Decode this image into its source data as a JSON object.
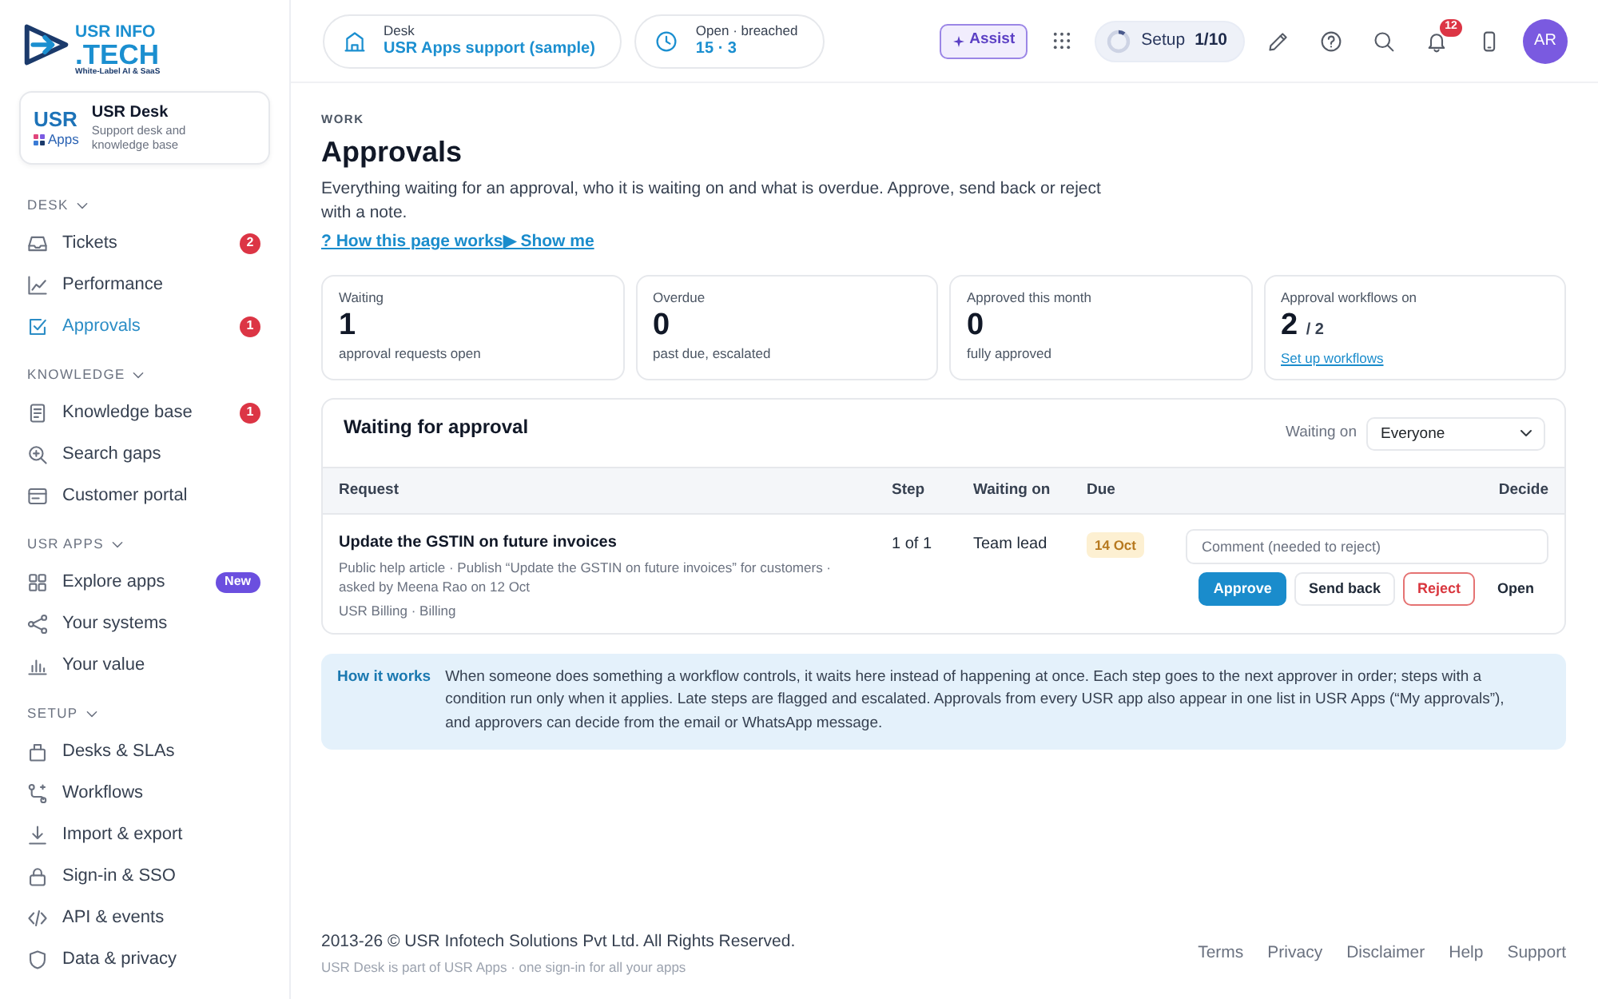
{
  "logo": {
    "title": "USR INFO",
    "subtitle": ".TECH",
    "tagline": "White-Label AI & SaaS"
  },
  "app_card": {
    "mark": "USR",
    "mark_caption": "Apps",
    "name": "USR Desk",
    "description": "Support desk and knowledge base"
  },
  "sidebar": {
    "sections": [
      {
        "title": "DESK",
        "expanded": true,
        "items": [
          {
            "label": "Tickets",
            "selected": false,
            "badge": {
              "text": "2",
              "kind": "count"
            }
          },
          {
            "label": "Performance",
            "selected": false
          },
          {
            "label": "Approvals",
            "selected": true,
            "badge": {
              "text": "1",
              "kind": "count"
            }
          }
        ]
      },
      {
        "title": "KNOWLEDGE",
        "expanded": true,
        "items": [
          {
            "label": "Knowledge base",
            "selected": false,
            "badge": {
              "text": "1",
              "kind": "count"
            }
          },
          {
            "label": "Search gaps",
            "selected": false
          },
          {
            "label": "Customer portal",
            "selected": false
          }
        ]
      },
      {
        "title": "USR APPS",
        "expanded": true,
        "items": [
          {
            "label": "Explore apps",
            "selected": false,
            "badge": {
              "text": "New",
              "kind": "new"
            }
          },
          {
            "label": "Your systems",
            "selected": false
          },
          {
            "label": "Your value",
            "selected": false
          }
        ]
      },
      {
        "title": "SETUP",
        "expanded": true,
        "items": [
          {
            "label": "Desks & SLAs",
            "selected": false
          },
          {
            "label": "Workflows",
            "selected": false
          },
          {
            "label": "Import & export",
            "selected": false
          },
          {
            "label": "Sign-in & SSO",
            "selected": false
          },
          {
            "label": "API & events",
            "selected": false
          },
          {
            "label": "Data & privacy",
            "selected": false
          }
        ]
      }
    ]
  },
  "topbar": {
    "pills": [
      {
        "label": "Desk",
        "value": "USR Apps support (sample)"
      },
      {
        "label": "Open · breached",
        "value": "15 · 3"
      }
    ],
    "assist": {
      "label": "Assist"
    },
    "setup": {
      "label": "Setup",
      "progress": "1/10",
      "level": 0.1
    },
    "notifications": {
      "count": "12"
    },
    "avatar": {
      "initials": "AR"
    }
  },
  "page": {
    "eyebrow": "WORK",
    "title": "Approvals",
    "description": "Everything waiting for an approval, who it is waiting on and what is overdue. Approve, send back or reject with a note.",
    "links": [
      "? How this page works",
      "▶ Show me"
    ]
  },
  "stats": [
    {
      "label": "Waiting",
      "value": "1",
      "note": "approval requests open"
    },
    {
      "label": "Overdue",
      "value": "0",
      "note": "past due, escalated"
    },
    {
      "label": "Approved this month",
      "value": "0",
      "note": "fully approved"
    },
    {
      "label": "Approval workflows on",
      "value": "2",
      "total": "/ 2",
      "link": "Set up workflows"
    }
  ],
  "approvals": {
    "title": "Waiting for approval",
    "filter": {
      "label": "Waiting on",
      "value": "Everyone"
    },
    "columns": [
      "Request",
      "Step",
      "Waiting on",
      "Due",
      "Decide"
    ],
    "rows": [
      {
        "title": "Update the GSTIN on future invoices",
        "details": "Public help article · Publish “Update the GSTIN on future invoices” for customers · asked by Meena Rao on 12 Oct",
        "source": "USR Billing · Billing",
        "step": "1 of 1",
        "waiting_on": "Team lead",
        "due": "14 Oct",
        "comment": {
          "placeholder": "Comment (needed to reject)"
        },
        "actions": [
          {
            "label": "Approve",
            "kind": "primary"
          },
          {
            "label": "Send back",
            "kind": "secondary"
          },
          {
            "label": "Reject",
            "kind": "danger"
          },
          {
            "label": "Open",
            "kind": "plain"
          }
        ]
      }
    ]
  },
  "how_it_works": {
    "label": "How it works",
    "text": "When someone does something a workflow controls, it waits here instead of happening at once. Each step goes to the next approver in order; steps with a condition run only when it applies. Late steps are flagged and escalated. Approvals from every USR app also appear in one list in USR Apps (“My approvals”), and approvers can decide from the email or WhatsApp message."
  },
  "footer": {
    "copyright": "2013-26 © USR Infotech Solutions Pvt Ltd. All Rights Reserved.",
    "note": "USR Desk is part of USR Apps · one sign-in for all your apps",
    "links": [
      "Terms",
      "Privacy",
      "Disclaimer",
      "Help",
      "Support"
    ]
  }
}
